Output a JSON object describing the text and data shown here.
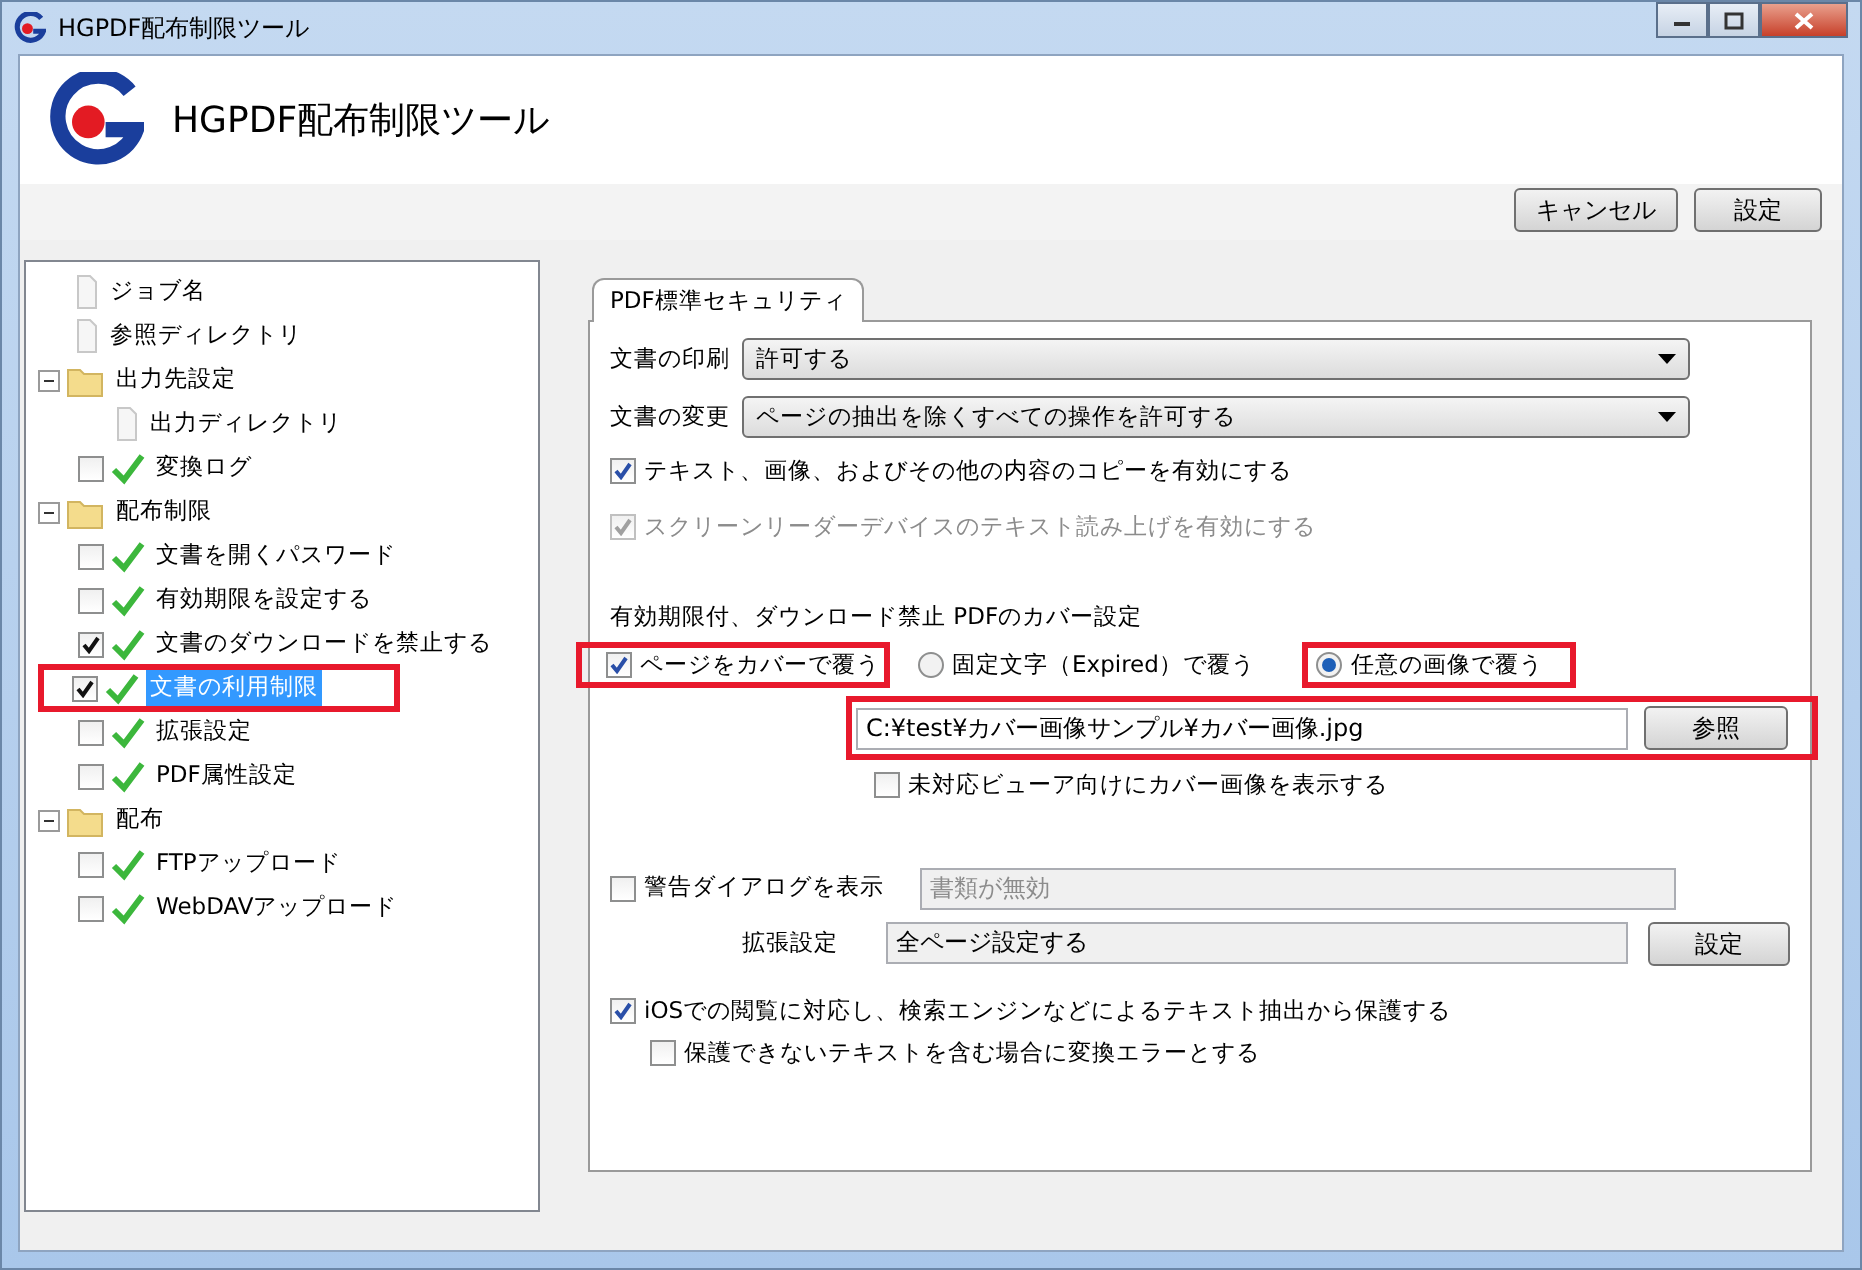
{
  "window": {
    "title": "HGPDF配布制限ツール"
  },
  "header": {
    "title": "HGPDF配布制限ツール"
  },
  "toolbar": {
    "buttons": [
      "キャンセル",
      "設定"
    ]
  },
  "tree": [
    {
      "kind": "file",
      "label": "ジョブ名",
      "selected": false,
      "highlighted": false
    },
    {
      "kind": "file",
      "label": "参照ディレクトリ",
      "selected": false,
      "highlighted": false
    },
    {
      "kind": "folder",
      "label": "出力先設定",
      "expanded": true,
      "selected": false,
      "highlighted": false,
      "children": [
        {
          "kind": "file",
          "label": "出力ディレクトリ",
          "selected": false,
          "highlighted": false
        },
        {
          "kind": "check",
          "label": "変換ログ",
          "checked": false,
          "selected": false,
          "highlighted": false
        }
      ]
    },
    {
      "kind": "folder",
      "label": "配布制限",
      "expanded": true,
      "selected": false,
      "highlighted": false,
      "children": [
        {
          "kind": "check",
          "label": "文書を開くパスワード",
          "checked": false,
          "selected": false,
          "highlighted": false
        },
        {
          "kind": "check",
          "label": "有効期限を設定する",
          "checked": false,
          "selected": false,
          "highlighted": false
        },
        {
          "kind": "check",
          "label": "文書のダウンロードを禁止する",
          "checked": true,
          "selected": false,
          "highlighted": false
        },
        {
          "kind": "check",
          "label": "文書の利用制限",
          "checked": true,
          "selected": true,
          "highlighted": true
        },
        {
          "kind": "check",
          "label": "拡張設定",
          "checked": false,
          "selected": false,
          "highlighted": false
        },
        {
          "kind": "check",
          "label": "PDF属性設定",
          "checked": false,
          "selected": false,
          "highlighted": false
        }
      ]
    },
    {
      "kind": "folder",
      "label": "配布",
      "expanded": true,
      "selected": false,
      "highlighted": false,
      "children": [
        {
          "kind": "check",
          "label": "FTPアップロード",
          "checked": false,
          "selected": false,
          "highlighted": false
        },
        {
          "kind": "check",
          "label": "WebDAVアップロード",
          "checked": false,
          "selected": false,
          "highlighted": false
        }
      ]
    }
  ],
  "panel": {
    "tab": {
      "label": "PDF標準セキュリティ",
      "selected": true
    },
    "print": {
      "label": "文書の印刷",
      "value": "許可する"
    },
    "modify": {
      "label": "文書の変更",
      "value": "ページの抽出を除くすべての操作を許可する"
    },
    "copy_option": {
      "label": "テキスト、画像、およびその他の内容のコピーを有効にする",
      "checked": true,
      "disabled": false
    },
    "reader_option": {
      "label": "スクリーンリーダーデバイスのテキスト読み上げを有効にする",
      "checked": true,
      "disabled": true
    },
    "cover": {
      "heading": "有効期限付、ダウンロード禁止 PDFのカバー設定",
      "cover_check": {
        "label": "ページをカバーで覆う",
        "checked": true,
        "highlighted": true
      },
      "radios": [
        {
          "label": "固定文字（Expired）で覆う",
          "selected": false,
          "highlighted": false
        },
        {
          "label": "任意の画像で覆う",
          "selected": true,
          "highlighted": true
        }
      ],
      "path": {
        "value": "C:¥test¥カバー画像サンプル¥カバー画像.jpg",
        "highlighted": true
      },
      "browse_button": "参照",
      "viewer_check": {
        "label": "未対応ビューア向けにカバー画像を表示する",
        "checked": false
      }
    },
    "warning": {
      "label": "警告ダイアログを表示",
      "checked": false,
      "value": "書類が無効"
    },
    "extension": {
      "label": "拡張設定",
      "value": "全ページ設定する",
      "button": "設定"
    },
    "ios_check": {
      "label": "iOSでの閲覧に対応し、検索エンジンなどによるテキスト抽出から保護する",
      "checked": true
    },
    "error_check": {
      "label": "保護できないテキストを含む場合に変換エラーとする",
      "checked": false
    }
  }
}
